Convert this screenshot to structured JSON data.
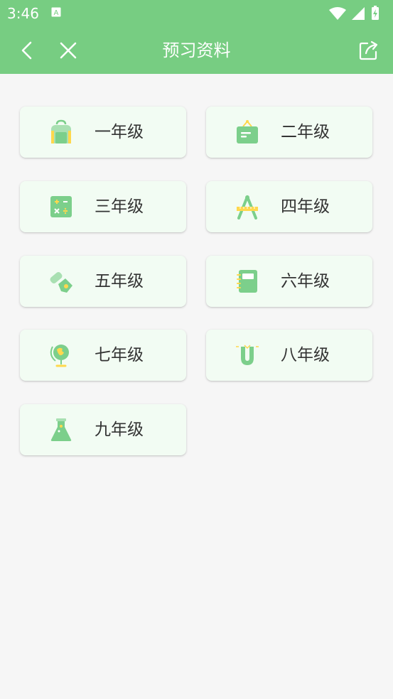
{
  "status_bar": {
    "time": "3:46"
  },
  "nav": {
    "title": "预习资料",
    "back_icon": "chevron-left-icon",
    "close_icon": "close-icon",
    "share_icon": "share-icon"
  },
  "colors": {
    "header": "#77cd82",
    "background": "#f6f6f6",
    "card": "#f2fcf3",
    "icon_green": "#7ccf8b",
    "icon_yellow": "#ffd84d"
  },
  "grades": [
    {
      "label": "一年级",
      "icon": "backpack-icon"
    },
    {
      "label": "二年级",
      "icon": "folder-board-icon"
    },
    {
      "label": "三年级",
      "icon": "calculator-icon"
    },
    {
      "label": "四年级",
      "icon": "compass-ruler-icon"
    },
    {
      "label": "五年级",
      "icon": "pen-eraser-icon"
    },
    {
      "label": "六年级",
      "icon": "notebook-icon"
    },
    {
      "label": "七年级",
      "icon": "globe-icon"
    },
    {
      "label": "八年级",
      "icon": "magnet-icon"
    },
    {
      "label": "九年级",
      "icon": "flask-icon"
    }
  ]
}
